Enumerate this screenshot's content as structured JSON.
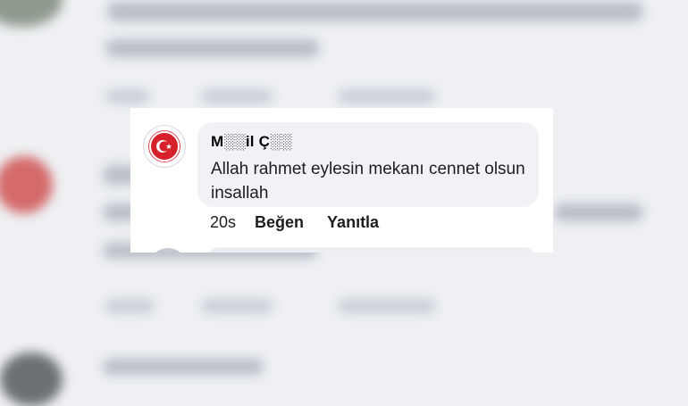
{
  "comment": {
    "author_name": "M░░il Ç░░",
    "text": "Allah rahmet eylesin mekanı cennet olsun insallah",
    "time": "20s",
    "like_label": "Beğen",
    "reply_label": "Yanıtla"
  },
  "colors": {
    "bubble": "#f0f2f5",
    "emblem_red": "#d6202a",
    "text": "#1c1e21"
  },
  "icons": {
    "avatar": "turkish-emblem-icon"
  }
}
